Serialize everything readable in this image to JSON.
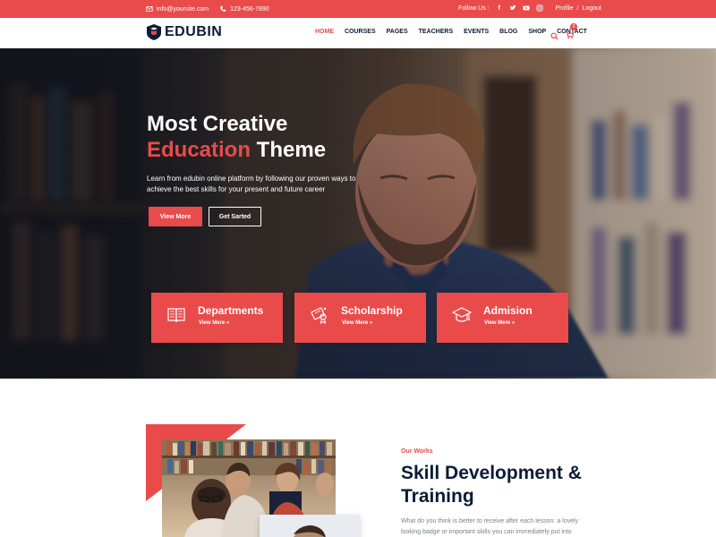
{
  "topbar": {
    "email": "info@yoursite.com",
    "phone": "123-456-7890",
    "follow_label": "Follow Us :",
    "social": [
      "f",
      "t",
      "y",
      "i"
    ],
    "profile": "Profile",
    "separator": "/",
    "logout": "Logout"
  },
  "header": {
    "logo_text": "EDUBIN",
    "nav": [
      {
        "label": "HOME",
        "active": true
      },
      {
        "label": "COURSES"
      },
      {
        "label": "PAGES"
      },
      {
        "label": "TEACHERS"
      },
      {
        "label": "EVENTS"
      },
      {
        "label": "BLOG"
      },
      {
        "label": "SHOP"
      },
      {
        "label": "CONTACT"
      }
    ],
    "cart_count": "0"
  },
  "hero": {
    "title_line1": "Most Creative",
    "title_accent": "Education",
    "title_rest": " Theme",
    "subtitle": "Learn from edubin online platform by following our proven ways to achieve the best skills for your present and future career",
    "btn_primary": "View More",
    "btn_secondary": "Get Sarted"
  },
  "cards": [
    {
      "title": "Departments",
      "more": "View Mere »",
      "icon": "book-icon"
    },
    {
      "title": "Scholarship",
      "more": "View Mere »",
      "icon": "diploma-icon"
    },
    {
      "title": "Admision",
      "more": "View Mere »",
      "icon": "graduation-cap-icon"
    }
  ],
  "about": {
    "eyebrow": "Our Works",
    "title": "Skill Development & Training",
    "text": "What do you think is better to receive after each lesson: a lovely looking badge or important skills you can immediately put into"
  },
  "colors": {
    "accent": "#e94b4b",
    "dark": "#0c1b36"
  }
}
